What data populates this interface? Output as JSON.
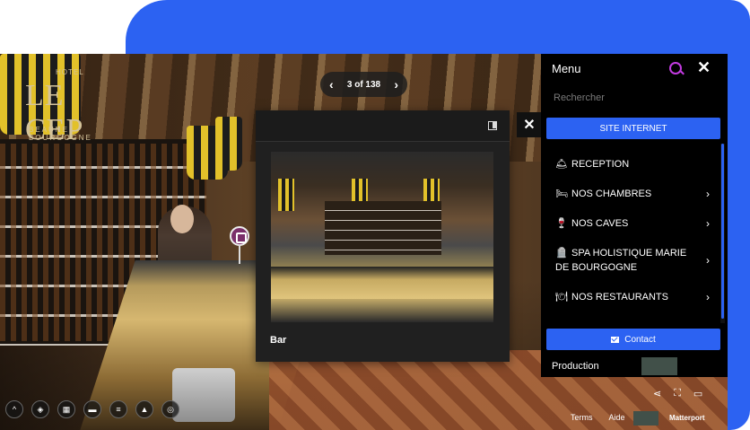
{
  "logo": {
    "top": "HOTEL",
    "main": "LE CEP",
    "sub": "BEAUNE BOURGOGNE"
  },
  "pagination": {
    "prev_icon": "chevron-left-icon",
    "next_icon": "chevron-right-icon",
    "label": "3 of 138"
  },
  "popup": {
    "title": "Bar",
    "expand_icon": "expand-icon",
    "close_label": "✕"
  },
  "menu": {
    "title": "Menu",
    "search_icon": "search-icon",
    "close_label": "✕",
    "search_placeholder": "Rechercher",
    "site_button": "SITE INTERNET",
    "items": [
      {
        "emoji": "🛎",
        "label": "RECEPTION",
        "chevron": ""
      },
      {
        "emoji": "🛏",
        "label": "NOS CHAMBRES",
        "chevron": "›"
      },
      {
        "emoji": "🍷",
        "label": "NOS CAVES",
        "chevron": "›"
      },
      {
        "emoji": "🪦",
        "label": "SPA HOLISTIQUE MARIE DE BOURGOGNE",
        "chevron": "›"
      },
      {
        "emoji": "🍽",
        "label": "NOS RESTAURANTS",
        "chevron": "›"
      }
    ],
    "contact_button": "Contact",
    "production_label": "Production"
  },
  "toolbar": {
    "buttons": [
      "chevron-up-icon",
      "tag-icon",
      "floorplan-icon",
      "measure-icon",
      "layers-icon",
      "map-icon",
      "360-icon"
    ]
  },
  "footer": {
    "terms": "Terms",
    "help": "Aide",
    "brand": "Matterport"
  },
  "colors": {
    "accent_blue": "#2c62f2",
    "search_magenta": "#c23be0",
    "menu_bg": "#000000"
  }
}
